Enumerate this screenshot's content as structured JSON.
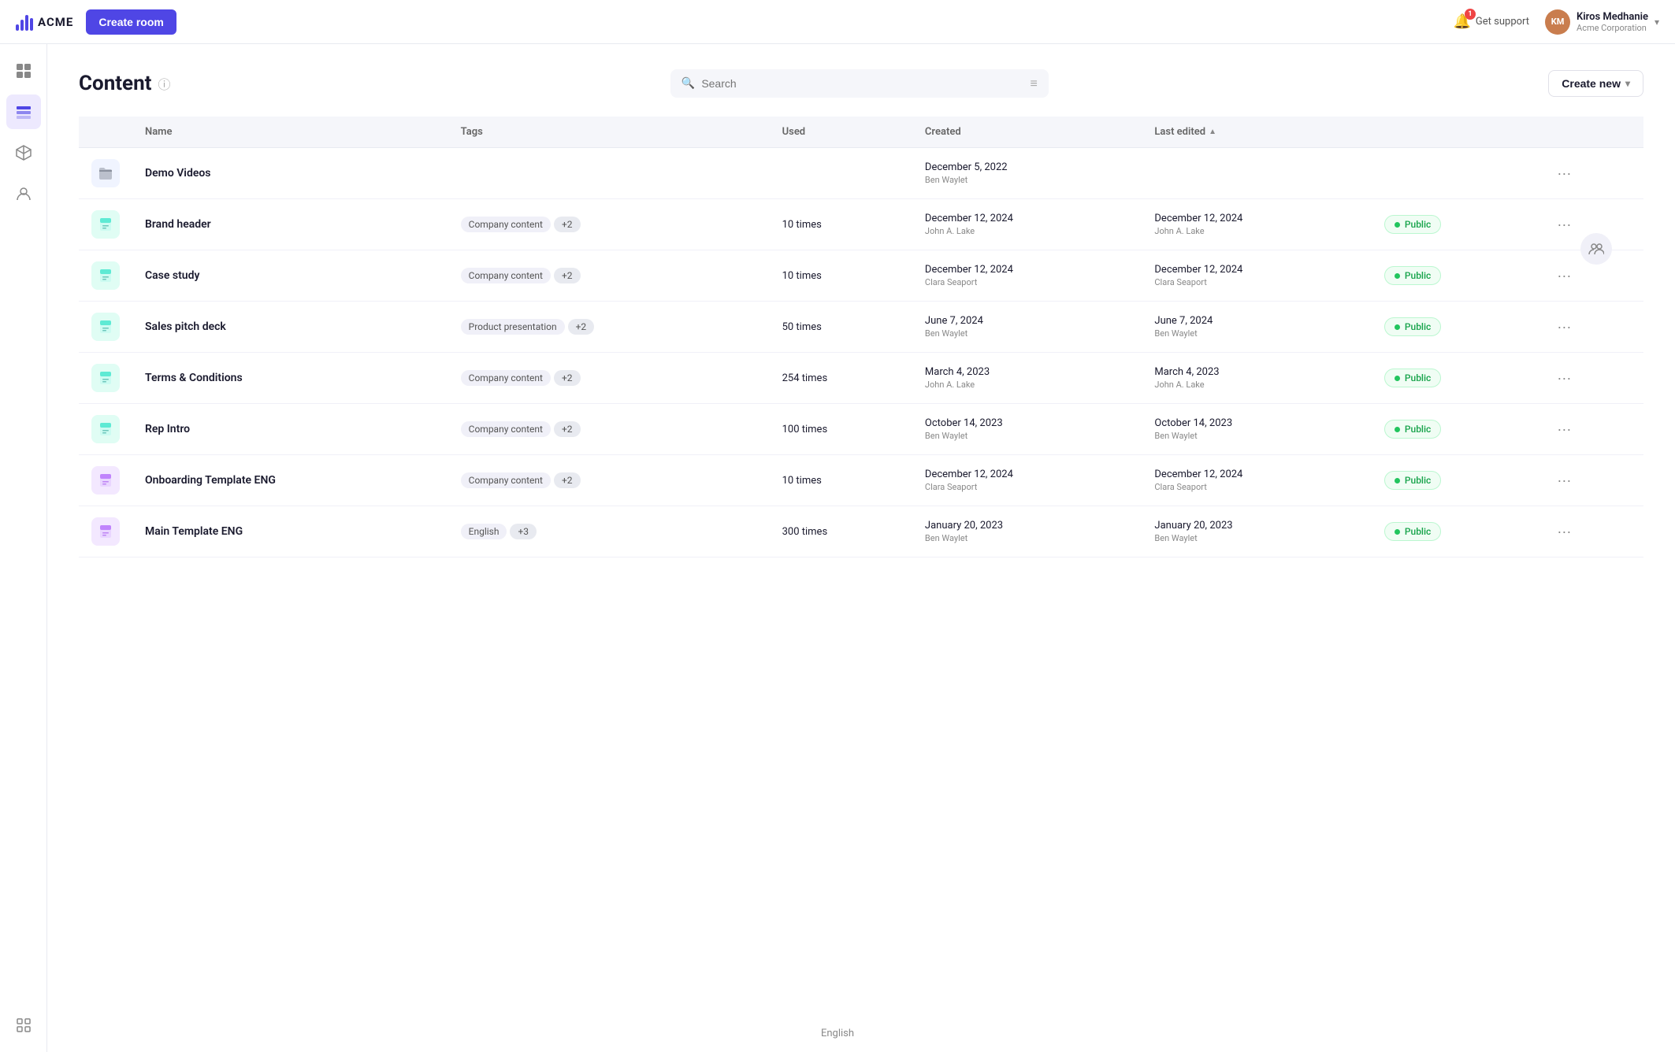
{
  "app": {
    "logo_text": "ACME",
    "create_room_label": "Create room"
  },
  "nav": {
    "support_label": "Get support",
    "notification_count": "1",
    "user_name": "Kiros Medhanie",
    "user_org": "Acme Corporation"
  },
  "sidebar": {
    "items": [
      {
        "id": "grid",
        "icon": "⊞",
        "active": false
      },
      {
        "id": "layers",
        "icon": "◧",
        "active": true
      },
      {
        "id": "cube",
        "icon": "⬡",
        "active": false
      },
      {
        "id": "contacts",
        "icon": "👤",
        "active": false
      }
    ],
    "bottom_items": [
      {
        "id": "settings",
        "icon": "⬛",
        "active": false
      }
    ]
  },
  "page": {
    "title": "Content",
    "search_placeholder": "Search",
    "create_new_label": "Create new",
    "table": {
      "columns": [
        "Name",
        "Tags",
        "Used",
        "Created",
        "Last edited"
      ],
      "rows": [
        {
          "id": 1,
          "icon_type": "folder",
          "name": "Demo Videos",
          "tags": [],
          "used": "",
          "created_date": "December 5, 2022",
          "created_author": "Ben Waylet",
          "edited_date": "",
          "edited_author": "",
          "status": ""
        },
        {
          "id": 2,
          "icon_type": "doc",
          "name": "Brand header",
          "tags": [
            "Company content"
          ],
          "tag_count": "+2",
          "used": "10 times",
          "created_date": "December 12, 2024",
          "created_author": "John A. Lake",
          "edited_date": "December 12, 2024",
          "edited_author": "John A. Lake",
          "status": "Public"
        },
        {
          "id": 3,
          "icon_type": "doc",
          "name": "Case study",
          "tags": [
            "Company content"
          ],
          "tag_count": "+2",
          "used": "10 times",
          "created_date": "December 12, 2024",
          "created_author": "Clara Seaport",
          "edited_date": "December 12, 2024",
          "edited_author": "Clara Seaport",
          "status": "Public"
        },
        {
          "id": 4,
          "icon_type": "doc",
          "name": "Sales pitch deck",
          "tags": [
            "Product presentation"
          ],
          "tag_count": "+2",
          "used": "50 times",
          "created_date": "June 7, 2024",
          "created_author": "Ben Waylet",
          "edited_date": "June 7, 2024",
          "edited_author": "Ben Waylet",
          "status": "Public"
        },
        {
          "id": 5,
          "icon_type": "doc",
          "name": "Terms & Conditions",
          "tags": [
            "Company content"
          ],
          "tag_count": "+2",
          "used": "254 times",
          "created_date": "March 4, 2023",
          "created_author": "John A. Lake",
          "edited_date": "March 4, 2023",
          "edited_author": "John A. Lake",
          "status": "Public"
        },
        {
          "id": 6,
          "icon_type": "doc",
          "name": "Rep Intro",
          "tags": [
            "Company content"
          ],
          "tag_count": "+2",
          "used": "100 times",
          "created_date": "October 14, 2023",
          "created_author": "Ben Waylet",
          "edited_date": "October 14, 2023",
          "edited_author": "Ben Waylet",
          "status": "Public"
        },
        {
          "id": 7,
          "icon_type": "template",
          "name": "Onboarding Template ENG",
          "tags": [
            "Company content"
          ],
          "tag_count": "+2",
          "used": "10 times",
          "created_date": "December 12, 2024",
          "created_author": "Clara Seaport",
          "edited_date": "December 12, 2024",
          "edited_author": "Clara Seaport",
          "status": "Public"
        },
        {
          "id": 8,
          "icon_type": "template",
          "name": "Main Template ENG",
          "tags": [
            "English"
          ],
          "tag_count": "+3",
          "used": "300 times",
          "created_date": "January 20, 2023",
          "created_author": "Ben Waylet",
          "edited_date": "January 20, 2023",
          "edited_author": "Ben Waylet",
          "status": "Public"
        }
      ]
    }
  },
  "footer": {
    "language": "English"
  }
}
